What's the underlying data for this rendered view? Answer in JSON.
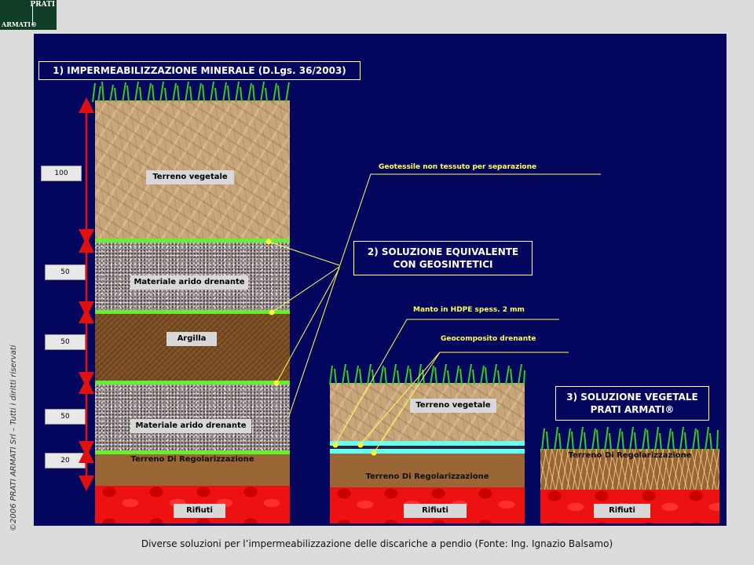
{
  "logo": {
    "line1": "PRATI",
    "line2": "ARMATI®"
  },
  "copyright": "©2006 PRATI ARMATI Srl – Tutti i diritti riservati",
  "caption": "Diverse soluzioni per l’impermeabilizzazione delle discariche a pendio (Fonte: Ing. Ignazio Balsamo)",
  "titles": {
    "solution1": "1)  IMPERMEABILIZZAZIONE MINERALE (D.Lgs. 36/2003)",
    "solution2_line1": "2)  SOLUZIONE EQUIVALENTE",
    "solution2_line2": "CON GEOSINTETICI",
    "solution3_line1": "3)  SOLUZIONE VEGETALE",
    "solution3_line2": "PRATI ARMATI®"
  },
  "column1": {
    "layers": {
      "topsoil": "Terreno vegetale",
      "drain_upper": "Materiale arido drenante",
      "clay": "Argilla",
      "drain_lower": "Materiale arido drenante",
      "regularization": "Terreno Di Regolarizzazione",
      "waste": "Rifiuti"
    },
    "thicknesses": [
      "100",
      "50",
      "50",
      "50",
      "20"
    ]
  },
  "column2": {
    "layers": {
      "topsoil": "Terreno vegetale",
      "regularization": "Terreno Di Regolarizzazione",
      "waste": "Rifiuti"
    }
  },
  "column3": {
    "layers": {
      "regularization": "Terreno Di Regolarizzazione",
      "waste": "Rifiuti"
    }
  },
  "callouts": {
    "geotextile": "Geotessile non tessuto per separazione",
    "hdpe": "Manto in HDPE spess. 2 mm",
    "geocomposite": "Geocomposito drenante"
  },
  "colors": {
    "panel_bg": "#05075f",
    "geotextile_line": "#66ee33",
    "geocomposite_line": "#66ffee",
    "callout_text": "#ffff55",
    "waste": "#ee1111"
  }
}
